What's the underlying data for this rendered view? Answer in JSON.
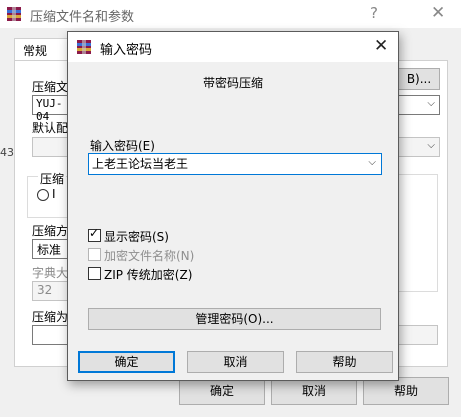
{
  "background_window": {
    "title": "压缩文件名和参数",
    "help_glyph": "?",
    "close_glyph": "✕",
    "tab_general": "常规",
    "archive_name_label": "压缩文",
    "archive_name_value": "YUJ-04",
    "browse_fragment": "B)...",
    "default_profile_label": "默认配",
    "format_group_label": "压缩",
    "format_radio_fragment": "I",
    "method_label": "压缩方",
    "method_value": "标准",
    "dict_label": "字典大",
    "dict_value": "32",
    "split_label": "压缩为",
    "ok": "确定",
    "cancel": "取消",
    "help": "帮助",
    "left_edge_fragment": "43"
  },
  "dialog": {
    "title": "输入密码",
    "close_glyph": "✕",
    "heading": "带密码压缩",
    "password_label": "输入密码(E)",
    "password_value": "上老王论坛当老王",
    "options": [
      {
        "label": "显示密码(S)",
        "checked": true,
        "enabled": true
      },
      {
        "label": "加密文件名称(N)",
        "checked": false,
        "enabled": false
      },
      {
        "label": "ZIP 传统加密(Z)",
        "checked": false,
        "enabled": true
      }
    ],
    "check_glyph": "✓",
    "manage_button": "管理密码(O)...",
    "ok": "确定",
    "cancel": "取消",
    "help": "帮助"
  },
  "colors": {
    "focus": "#0078d7",
    "dialog_bg": "#f0f0f0",
    "button_bg": "#e1e1e1"
  }
}
